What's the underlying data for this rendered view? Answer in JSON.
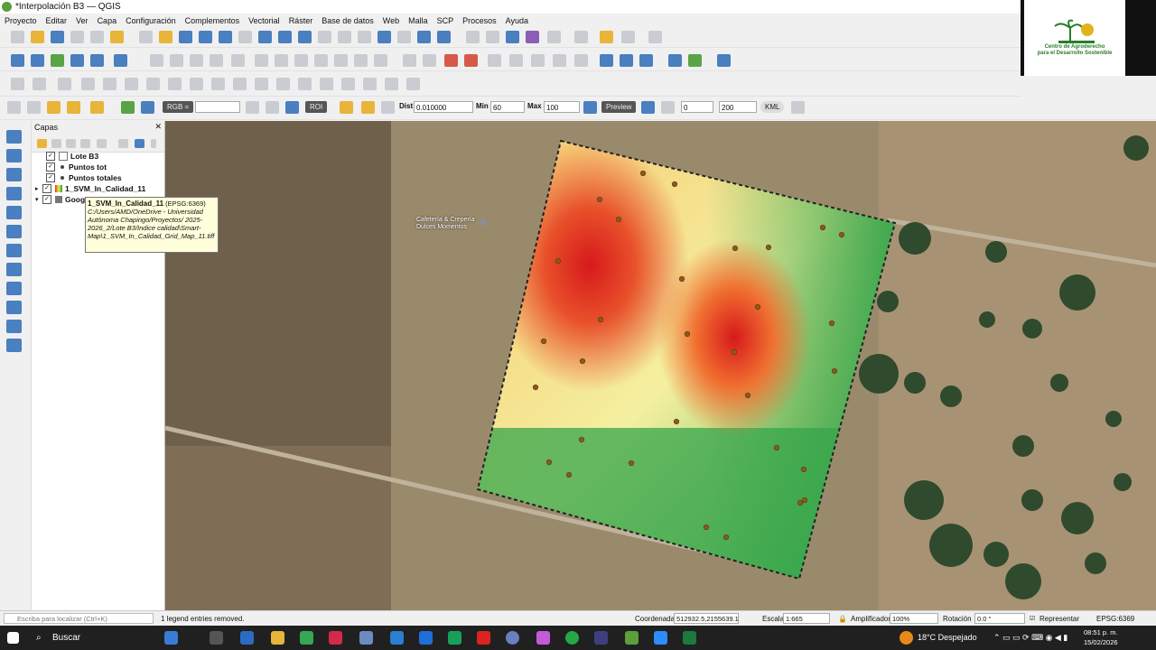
{
  "window": {
    "title": "*Interpolación B3 — QGIS"
  },
  "menu": [
    "Proyecto",
    "Editar",
    "Ver",
    "Capa",
    "Configuración",
    "Complementos",
    "Vectorial",
    "Ráster",
    "Base de datos",
    "Web",
    "Malla",
    "SCP",
    "Procesos",
    "Ayuda"
  ],
  "logo": {
    "text": "Centro de Agroderecho\npara el Desarrollo Sostenible",
    "colors": {
      "green": "#2a7d2a",
      "gold": "#e2b21b"
    }
  },
  "scp_toolbar": {
    "rgb_label": "RGB =",
    "rgb_value": "",
    "roi_label": "ROI",
    "dist_label": "Dist",
    "dist_value": "0.010000",
    "min_label": "Min",
    "min_value": "60",
    "max_label": "Max",
    "max_value": "100",
    "preview_label": "Preview",
    "t_value": "0",
    "s_value": "200",
    "kml_label": "KML"
  },
  "layers_panel": {
    "title": "Capas",
    "layers": [
      {
        "name": "Lote B3",
        "checked": true,
        "symbol": "empty"
      },
      {
        "name": "Puntos tot",
        "checked": true,
        "symbol": "point"
      },
      {
        "name": "Puntos totales",
        "checked": true,
        "symbol": "point"
      },
      {
        "name": "1_SVM_In_Calidad_11",
        "checked": true,
        "symbol": "raster"
      },
      {
        "name": "Google",
        "checked": true,
        "symbol": "raster"
      }
    ]
  },
  "tooltip": {
    "title": "1_SVM_In_Calidad_11",
    "crs": "(EPSG:6369)",
    "path": "C:/Users/AMD/OneDrive - Universidad Autónoma Chapingo/Proyectos/ 2025-2026_2/Lote B3/Indice calidad\\Smart-Map\\1_SVM_In_Calidad_Grid_Map_11.tiff"
  },
  "map": {
    "label": "Cafetería & Crepería Dulces Momentos"
  },
  "status": {
    "search_placeholder": "Escriba para localizar (Ctrl+K)",
    "message": "1 legend entries removed.",
    "coord_label": "Coordenada",
    "coord_value": "512932.5,2155639.1",
    "scale_label": "Escala",
    "scale_value": "1:665",
    "magnifier_label": "Amplificador",
    "magnifier_value": "100%",
    "rotation_label": "Rotación",
    "rotation_value": "0.0 °",
    "render_label": "Representar",
    "crs": "EPSG:6369"
  },
  "taskbar": {
    "search": "Buscar",
    "weather": "18°C  Despejado",
    "time": "08:51 p. m.",
    "date": "15/02/2026"
  }
}
